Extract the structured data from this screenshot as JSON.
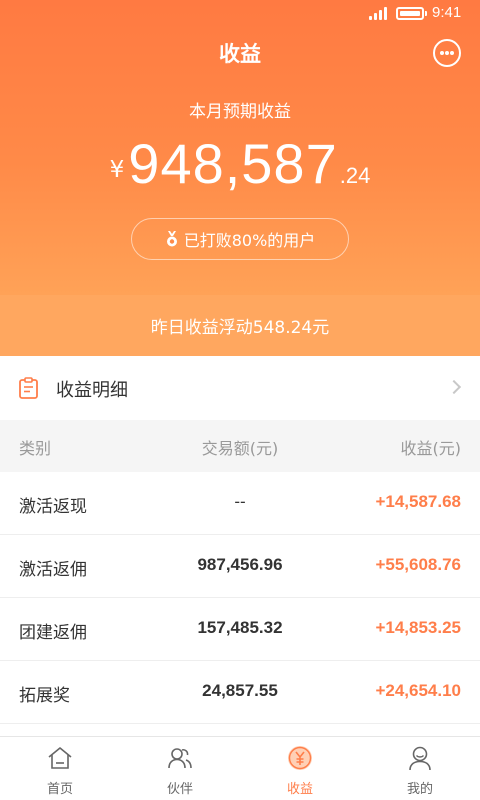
{
  "status_bar": {
    "time": "9:41"
  },
  "header": {
    "title": "收益"
  },
  "summary": {
    "month_label": "本月预期收益",
    "currency": "¥",
    "amount_main": "948,587",
    "amount_decimal": ".24",
    "beat_text": "已打败80%的用户",
    "yesterday_text": "昨日收益浮动548.24元"
  },
  "detail": {
    "label": "收益明细"
  },
  "table": {
    "headers": [
      "类别",
      "交易额(元)",
      "收益(元)"
    ],
    "rows": [
      {
        "category": "激活返现",
        "volume": "--",
        "income": "+14,587.68"
      },
      {
        "category": "激活返佣",
        "volume": "987,456.96",
        "income": "+55,608.76"
      },
      {
        "category": "团建返佣",
        "volume": "157,485.32",
        "income": "+14,853.25"
      },
      {
        "category": "拓展奖",
        "volume": "24,857.55",
        "income": "+24,654.10"
      }
    ]
  },
  "tabbar": {
    "items": [
      {
        "label": "首页",
        "icon": "home-icon"
      },
      {
        "label": "伙伴",
        "icon": "partners-icon"
      },
      {
        "label": "收益",
        "icon": "yen-coin-icon",
        "active": true
      },
      {
        "label": "我的",
        "icon": "user-icon"
      }
    ]
  },
  "colors": {
    "accent": "#ff7e4a",
    "hero_top": "#ff7a42",
    "hero_bottom": "#ffa257"
  }
}
